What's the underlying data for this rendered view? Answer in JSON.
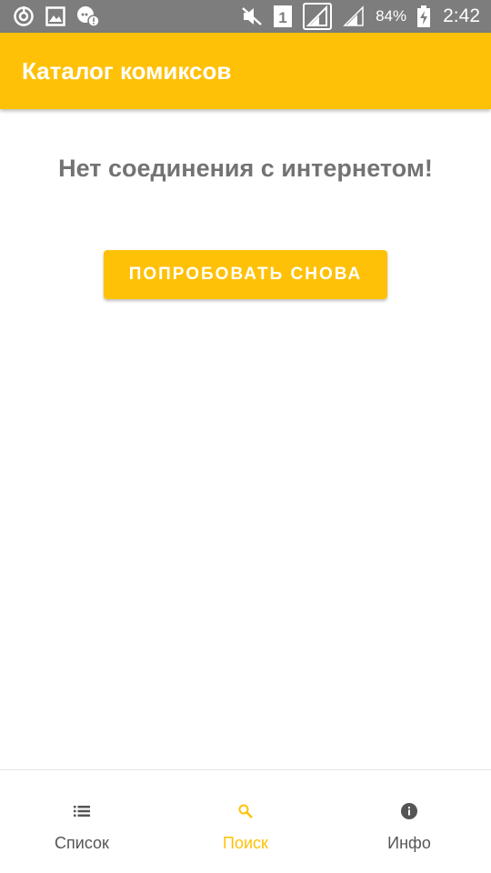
{
  "status_bar": {
    "icons_left": [
      "sync-icon",
      "image-icon",
      "chat-alert-icon"
    ],
    "icons_right": [
      "mute-icon",
      "sim-1-icon",
      "signal-icon",
      "signal-icon",
      "battery-charging-icon"
    ],
    "battery": "84%",
    "time": "2:42"
  },
  "app_bar": {
    "title": "Каталог комиксов"
  },
  "main": {
    "message": "Нет соединения с интернетом!",
    "retry_label": "ПОПРОБОВАТЬ СНОВА"
  },
  "bottom_nav": {
    "items": [
      {
        "label": "Список",
        "icon": "list-icon",
        "active": false
      },
      {
        "label": "Поиск",
        "icon": "search-icon",
        "active": true
      },
      {
        "label": "Инфо",
        "icon": "info-icon",
        "active": false
      }
    ]
  },
  "colors": {
    "accent": "#ffc107",
    "status_bar": "#7d7d7d",
    "message_text": "#737373",
    "nav_inactive": "#555555"
  }
}
